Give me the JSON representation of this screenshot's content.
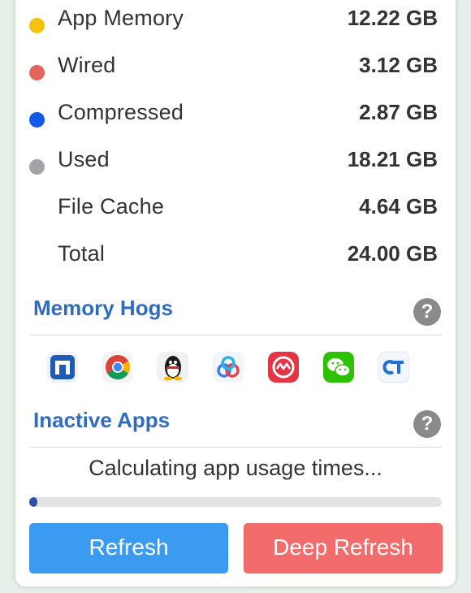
{
  "memory": {
    "rows": [
      {
        "label": "App Memory",
        "value": "12.22 GB",
        "color": "#f5c211"
      },
      {
        "label": "Wired",
        "value": "3.12 GB",
        "color": "#e2665e"
      },
      {
        "label": "Compressed",
        "value": "2.87 GB",
        "color": "#1359e8"
      },
      {
        "label": "Used",
        "value": "18.21 GB",
        "color": "#a3a3a8"
      },
      {
        "label": "File Cache",
        "value": "4.64 GB"
      },
      {
        "label": "Total",
        "value": "24.00 GB"
      }
    ]
  },
  "memory_hogs": {
    "title": "Memory Hogs",
    "help": "?",
    "apps": [
      {
        "icon": "maxthon-app-icon"
      },
      {
        "icon": "chrome-app-icon"
      },
      {
        "icon": "qq-penguin-app-icon"
      },
      {
        "icon": "baidu-netdisk-app-icon"
      },
      {
        "icon": "red-app-icon"
      },
      {
        "icon": "wechat-app-icon"
      },
      {
        "icon": "ct-app-icon"
      }
    ]
  },
  "inactive_apps": {
    "title": "Inactive Apps",
    "help": "?",
    "status": "Calculating app usage times...",
    "progress_fraction": 0.01
  },
  "buttons": {
    "refresh": "Refresh",
    "deep_refresh": "Deep Refresh"
  }
}
